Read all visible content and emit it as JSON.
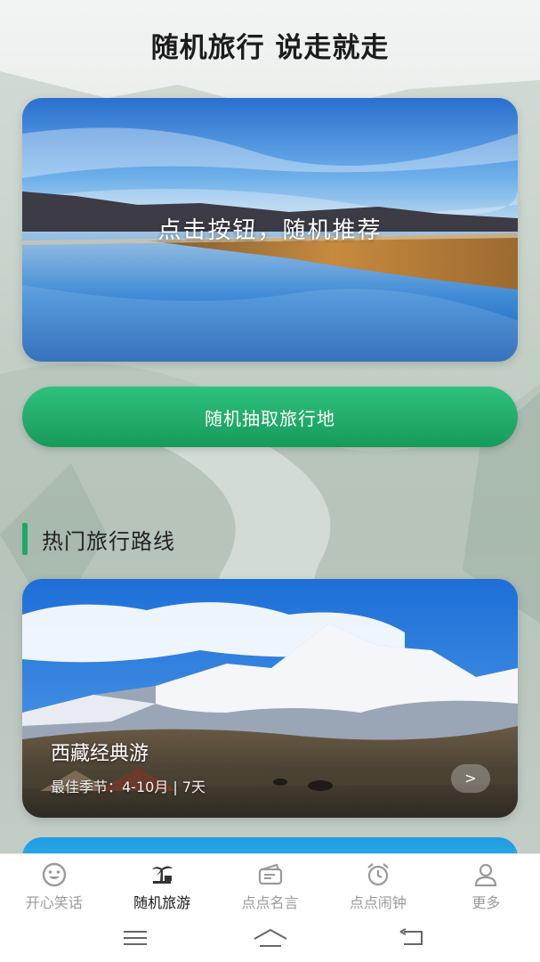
{
  "header": {
    "title": "随机旅行 说走就走"
  },
  "hero": {
    "prompt_text": "点击按钮，随机推荐"
  },
  "random_button": {
    "label": "随机抽取旅行地"
  },
  "section": {
    "title": "热门旅行路线"
  },
  "routes": [
    {
      "name": "西藏经典游",
      "meta": "最佳季节：4-10月 | 7天",
      "arrow": ">"
    }
  ],
  "tabs": [
    {
      "label": "开心笑话",
      "icon": "smiley-icon",
      "active": false
    },
    {
      "label": "随机旅游",
      "icon": "palm-tree-icon",
      "active": true
    },
    {
      "label": "点点名言",
      "icon": "card-icon",
      "active": false
    },
    {
      "label": "点点闹钟",
      "icon": "alarm-clock-icon",
      "active": false
    },
    {
      "label": "更多",
      "icon": "user-icon",
      "active": false
    }
  ],
  "system_nav": {
    "menu": "menu-icon",
    "home": "home-icon",
    "back": "back-icon"
  },
  "colors": {
    "accent": "#1ea866",
    "button_top": "#2fc17e",
    "button_bottom": "#169a5b",
    "tab_inactive": "#9a9a9a"
  }
}
